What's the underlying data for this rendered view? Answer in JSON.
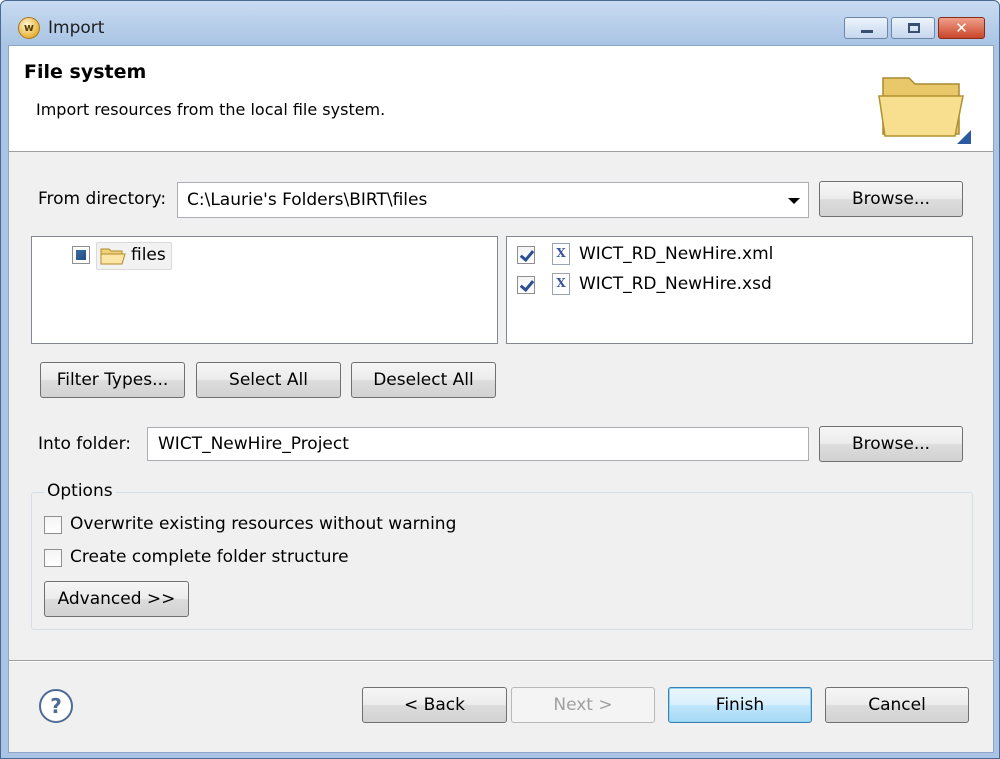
{
  "window": {
    "title": "Import",
    "app_icon_letter": "w"
  },
  "banner": {
    "title": "File system",
    "description": "Import resources from the local file system."
  },
  "source": {
    "from_directory_label": "From directory:",
    "from_directory_value": "C:\\Laurie's Folders\\BIRT\\files",
    "browse_label": "Browse..."
  },
  "tree": {
    "items": [
      {
        "label": "files",
        "state": "partial"
      }
    ]
  },
  "files": {
    "items": [
      {
        "label": "WICT_RD_NewHire.xml",
        "checked": true,
        "icon_letter": "X"
      },
      {
        "label": "WICT_RD_NewHire.xsd",
        "checked": true,
        "icon_letter": "X"
      }
    ]
  },
  "selection_buttons": {
    "filter_types": "Filter Types...",
    "select_all": "Select All",
    "deselect_all": "Deselect All"
  },
  "destination": {
    "into_folder_label": "Into folder:",
    "into_folder_value": "WICT_NewHire_Project",
    "browse_label": "Browse..."
  },
  "options": {
    "title": "Options",
    "overwrite_label": "Overwrite existing resources without warning",
    "overwrite_checked": false,
    "complete_folder_label": "Create complete folder structure",
    "complete_folder_checked": false,
    "advanced_label": "Advanced >>"
  },
  "footer": {
    "help_glyph": "?",
    "back_label": "< Back",
    "next_label": "Next >",
    "finish_label": "Finish",
    "cancel_label": "Cancel"
  },
  "colors": {
    "title_bar": "#a9c4e4",
    "default_button": "#bee6fd",
    "close_button": "#c9452b"
  }
}
